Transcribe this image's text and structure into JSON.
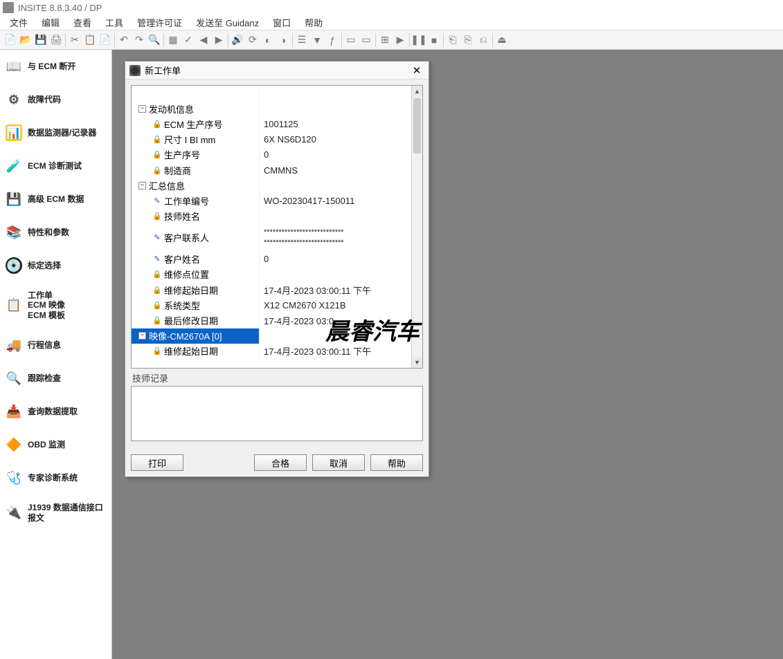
{
  "app": {
    "title": "INSITE 8.8.3.40  / DP"
  },
  "menu": [
    "文件",
    "编辑",
    "查看",
    "工具",
    "管理许可证",
    "发送至 Guidanz",
    "窗口",
    "帮助"
  ],
  "toolbar_icons": [
    "new",
    "open",
    "save",
    "print",
    "|",
    "cut",
    "copy",
    "paste",
    "|",
    "undo",
    "redo",
    "find",
    "|",
    "page",
    "check",
    "back",
    "fwd",
    "|",
    "sound",
    "refresh",
    "c1",
    "c2",
    "|",
    "list",
    "filter",
    "fn",
    "|",
    "rect1",
    "rect2",
    "|",
    "cols",
    "play",
    "|",
    "pause",
    "stop",
    "|",
    "t1",
    "t2",
    "t3",
    "|",
    "exit"
  ],
  "sidebar": [
    {
      "icon": "📖",
      "cls": "i-ecm",
      "label": "与 ECM 断开"
    },
    {
      "icon": "⚙",
      "cls": "i-fault",
      "label": "故障代码"
    },
    {
      "icon": "📊",
      "cls": "i-mon",
      "label": "数据监测器/记录器"
    },
    {
      "icon": "🧪",
      "cls": "i-diag",
      "label": "ECM 诊断测试"
    },
    {
      "icon": "💾",
      "cls": "i-adv",
      "label": "高级 ECM 数据"
    },
    {
      "icon": "📚",
      "cls": "i-feat",
      "label": "特性和参数"
    },
    {
      "icon": "💿",
      "cls": "i-cal",
      "label": "标定选择"
    },
    {
      "icon": "📋",
      "cls": "i-work",
      "label": "工作单\nECM 映像\nECM 模板"
    },
    {
      "icon": "🚚",
      "cls": "i-trip",
      "label": "行程信息"
    },
    {
      "icon": "🔍",
      "cls": "i-audit",
      "label": "跟踪检查"
    },
    {
      "icon": "📥",
      "cls": "i-query",
      "label": "查询数据提取"
    },
    {
      "icon": "🔶",
      "cls": "i-obd",
      "label": "OBD 监测"
    },
    {
      "icon": "🩺",
      "cls": "i-expert",
      "label": "专家诊断系统"
    },
    {
      "icon": "🔌",
      "cls": "i-j1939",
      "label": "J1939 数据通信接口报文"
    }
  ],
  "dialog": {
    "title": "新工作单",
    "rows": [
      {
        "type": "group",
        "exp": "-",
        "key": "发动机信息",
        "val": ""
      },
      {
        "type": "leaf",
        "icon": "lock",
        "key": "ECM 生产序号",
        "val": "1001125"
      },
      {
        "type": "leaf",
        "icon": "lock",
        "key": "尺寸 I  BI   mm",
        "val": "6X NS6D120"
      },
      {
        "type": "leaf",
        "icon": "lock",
        "key": "生产序号",
        "val": "0"
      },
      {
        "type": "leaf",
        "icon": "lock",
        "key": "制造商",
        "val": "CMMNS"
      },
      {
        "type": "group",
        "exp": "-",
        "key": "汇总信息",
        "val": ""
      },
      {
        "type": "leaf",
        "icon": "pen",
        "key": "工作单编号",
        "val": "WO-20230417-150011"
      },
      {
        "type": "leaf",
        "icon": "lock",
        "key": "技师姓名",
        "val": ""
      },
      {
        "type": "leaf",
        "icon": "pen",
        "key": "客户联系人",
        "val": "***************************\n***************************"
      },
      {
        "type": "leaf",
        "icon": "pen",
        "key": "客户姓名",
        "val": "0"
      },
      {
        "type": "leaf",
        "icon": "lock",
        "key": "维修点位置",
        "val": ""
      },
      {
        "type": "leaf",
        "icon": "lock",
        "key": "维修起始日期",
        "val": "17-4月-2023 03:00:11 下午"
      },
      {
        "type": "leaf",
        "icon": "lock",
        "key": "系统类型",
        "val": "X12 CM2670 X121B"
      },
      {
        "type": "leaf",
        "icon": "lock",
        "key": "最后修改日期",
        "val": "17-4月-2023 03:0"
      },
      {
        "type": "group",
        "exp": "-",
        "key": "映像-CM2670A [0]",
        "val": "",
        "selected": true
      },
      {
        "type": "leaf",
        "icon": "lock",
        "key": "维修起始日期",
        "val": "17-4月-2023 03:00:11 下午"
      }
    ],
    "notes_label": "技师记录",
    "notes_value": "",
    "buttons": {
      "print": "打印",
      "ok": "合格",
      "cancel": "取消",
      "help": "帮助"
    }
  },
  "watermark": "晨睿汽车"
}
